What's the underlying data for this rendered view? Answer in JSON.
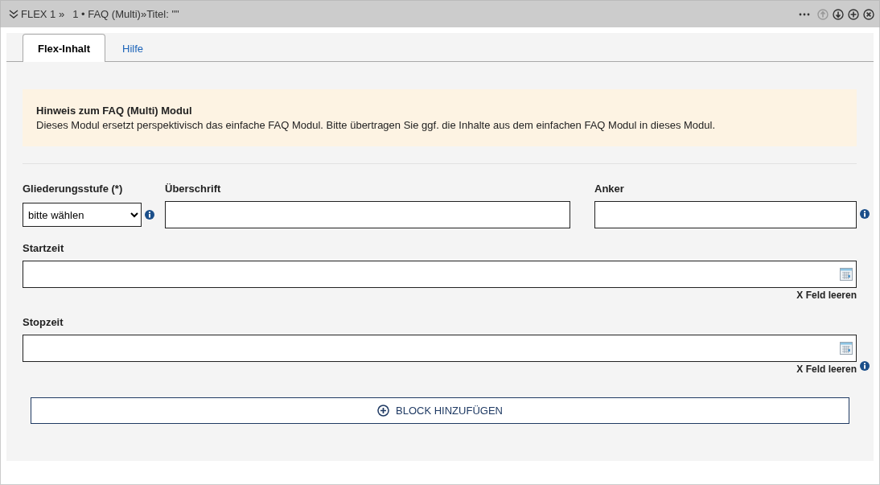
{
  "header": {
    "path": "FLEX 1 »",
    "title": "1 • FAQ (Multi)»Titel: \"\"",
    "actions": [
      {
        "kind": "more",
        "disabled": false
      },
      {
        "kind": "up",
        "disabled": true
      },
      {
        "kind": "down",
        "disabled": false
      },
      {
        "kind": "add",
        "disabled": false
      },
      {
        "kind": "close",
        "disabled": false
      }
    ]
  },
  "tabs": [
    {
      "label": "Flex-Inhalt",
      "selected": true
    },
    {
      "label": "Hilfe",
      "selected": false
    }
  ],
  "notice": {
    "title": "Hinweis zum FAQ (Multi) Modul",
    "text": "Dieses Modul ersetzt perspektivisch das einfache FAQ Modul. Bitte übertragen Sie ggf. die Inhalte aus dem einfachen FAQ Modul in dieses Modul."
  },
  "field_rows": [
    [
      {
        "kind": "select",
        "label": "Gliederungsstufe (*)",
        "value": "bitte wählen",
        "info": true
      },
      {
        "kind": "text",
        "label": "Überschrift",
        "info": false
      },
      {
        "kind": "text",
        "label": "Anker",
        "info": true
      }
    ],
    [
      {
        "kind": "date",
        "label": "Startzeit",
        "clear": "X Feld leeren",
        "info": false
      }
    ],
    [
      {
        "kind": "date",
        "label": "Stopzeit",
        "clear": "X Feld leeren",
        "info": true
      }
    ]
  ],
  "add_button": {
    "label": "BLOCK HINZUFÜGEN"
  }
}
